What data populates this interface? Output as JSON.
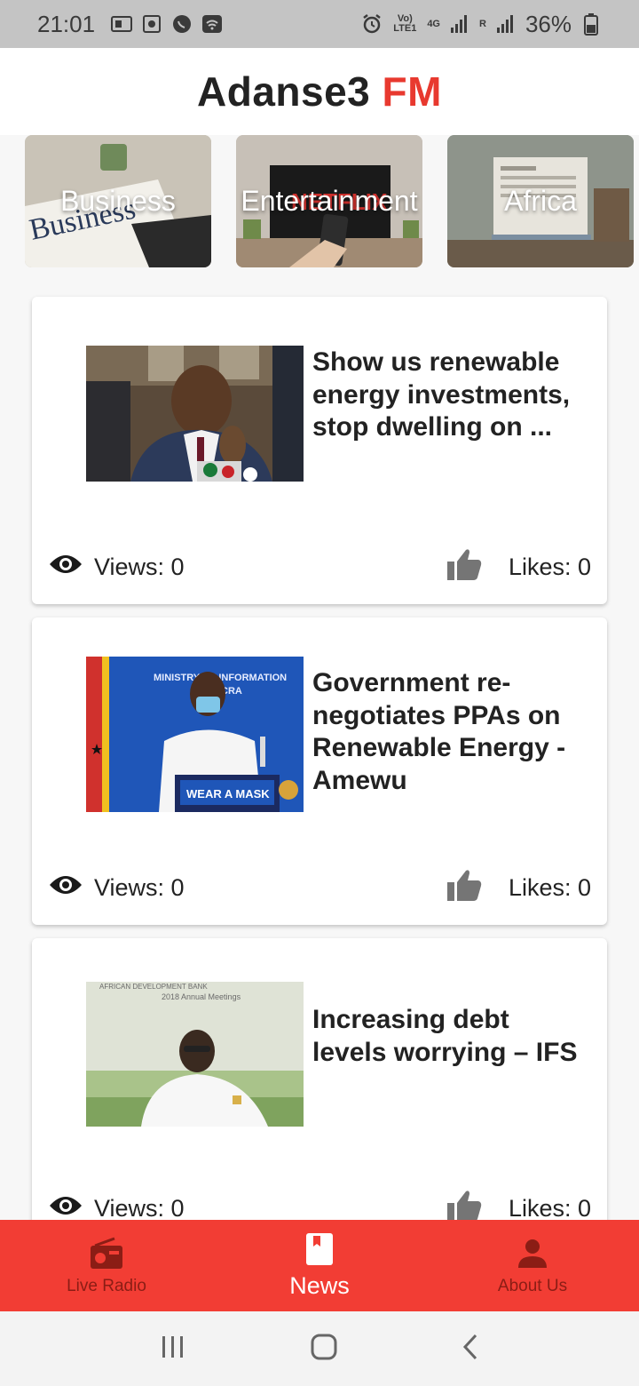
{
  "status_bar": {
    "time": "21:01",
    "network_label": "Vo) LTE1",
    "signal_label": "4G",
    "roaming_label": "R",
    "battery": "36%"
  },
  "app_title": {
    "main": "Adanse3",
    "accent": "FM"
  },
  "categories": [
    {
      "label": "Business",
      "icon": "newspaper-photo"
    },
    {
      "label": "Entertainment",
      "icon": "tv-remote-photo"
    },
    {
      "label": "Africa",
      "icon": "reading-newspaper-photo"
    }
  ],
  "articles": [
    {
      "headline": "Show us renewable energy investments, stop dwelling on ...",
      "views": "Views: 0",
      "likes": "Likes: 0"
    },
    {
      "headline": "Government re-negotiates PPAs on Renewable Energy - Amewu",
      "views": "Views: 0",
      "likes": "Likes: 0",
      "image_text": {
        "banner": "MINISTRY OF INFORMATION",
        "banner_sub": "CRA",
        "podium": "WEAR A MASK"
      }
    },
    {
      "headline": "Increasing debt levels worrying – IFS",
      "views": "Views: 0",
      "likes": "Likes: 0",
      "image_text": {
        "banner": "AFRICAN DEVELOPMENT BANK",
        "banner_sub": "2018 Annual Meetings"
      }
    }
  ],
  "bottom_nav": {
    "items": [
      {
        "label": "Live Radio",
        "icon": "radio-icon"
      },
      {
        "label": "News",
        "icon": "bookmark-icon",
        "active": true
      },
      {
        "label": "About Us",
        "icon": "person-icon"
      }
    ]
  },
  "colors": {
    "accent": "#e8392f",
    "nav_bg": "#f23d34",
    "nav_inactive": "#8b1d15"
  }
}
